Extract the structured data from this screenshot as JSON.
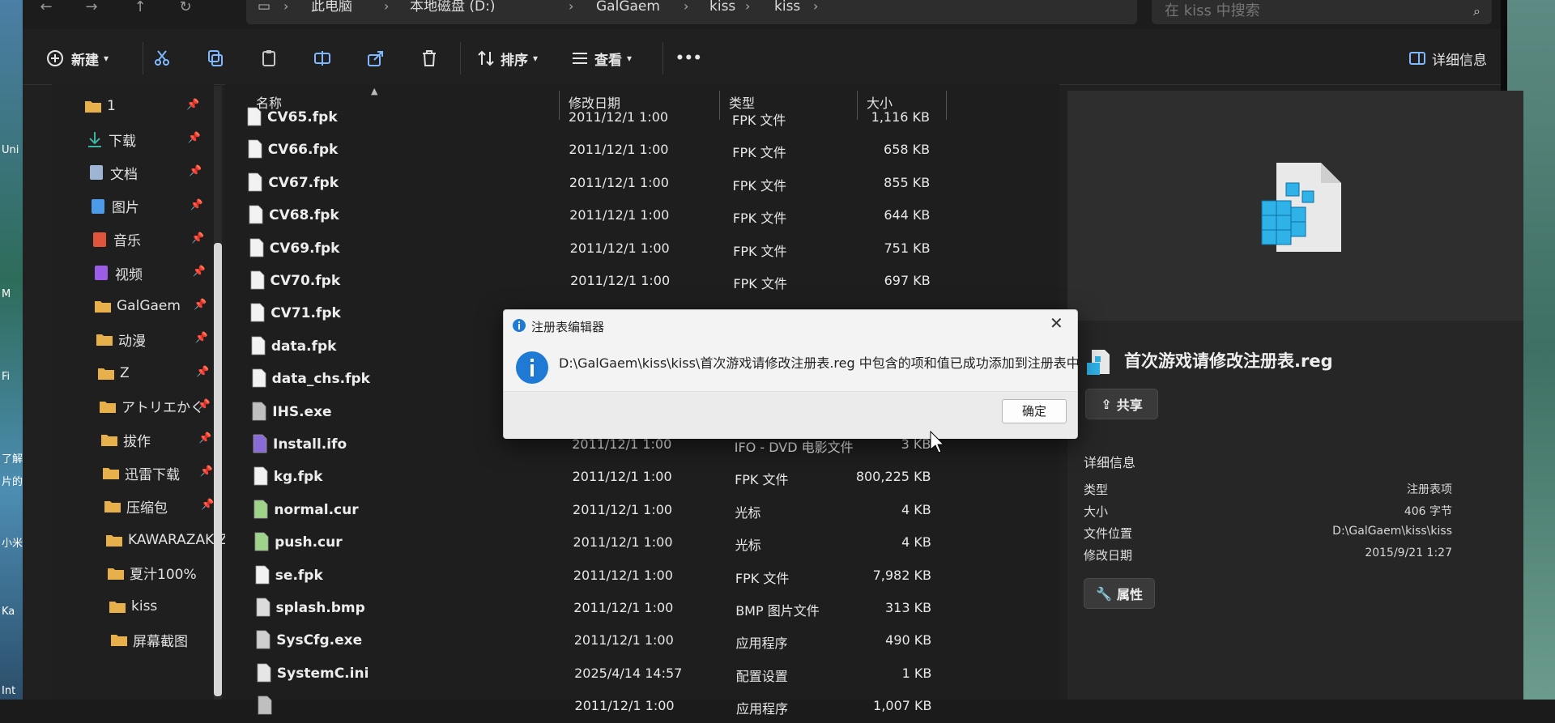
{
  "desktop": {
    "left_labels": [
      "Uni",
      "M",
      "Fi",
      "了解有",
      "片的",
      "小米",
      "Ka",
      "Int"
    ]
  },
  "address": {
    "crumbs": [
      "此电脑",
      "本地磁盘 (D:)",
      "GalGaem",
      "kiss",
      "kiss"
    ],
    "search_placeholder": "在 kiss 中搜索"
  },
  "toolbar": {
    "new_label": "新建",
    "sort_label": "排序",
    "view_label": "查看",
    "more_label": "•••",
    "details_label": "详细信息"
  },
  "sidebar": {
    "items": [
      {
        "label": "1",
        "icon": "folder-icon",
        "pinned": true
      },
      {
        "label": "下载",
        "icon": "download-icon",
        "pinned": true
      },
      {
        "label": "文档",
        "icon": "document-icon",
        "pinned": true
      },
      {
        "label": "图片",
        "icon": "pictures-icon",
        "pinned": true
      },
      {
        "label": "音乐",
        "icon": "music-icon",
        "pinned": true
      },
      {
        "label": "视频",
        "icon": "video-icon",
        "pinned": true
      },
      {
        "label": "GalGaem",
        "icon": "folder-icon",
        "pinned": true
      },
      {
        "label": "动漫",
        "icon": "folder-icon",
        "pinned": true
      },
      {
        "label": "Z",
        "icon": "folder-icon",
        "pinned": true
      },
      {
        "label": "アトリエかく",
        "icon": "folder-icon",
        "pinned": true
      },
      {
        "label": "拔作",
        "icon": "folder-icon",
        "pinned": true
      },
      {
        "label": "迅雷下载",
        "icon": "folder-icon",
        "pinned": true
      },
      {
        "label": "压缩包",
        "icon": "folder-icon",
        "pinned": true
      },
      {
        "label": "KAWARAZAKIZ",
        "icon": "folder-icon",
        "pinned": false
      },
      {
        "label": "夏汁100%",
        "icon": "folder-icon",
        "pinned": false
      },
      {
        "label": "kiss",
        "icon": "folder-icon",
        "pinned": false
      },
      {
        "label": "屏幕截图",
        "icon": "folder-icon",
        "pinned": false
      }
    ]
  },
  "columns": {
    "name": "名称",
    "date": "修改日期",
    "type": "类型",
    "size": "大小"
  },
  "files": [
    {
      "name": "CV65.fpk",
      "date": "2011/12/1 1:00",
      "type": "FPK 文件",
      "size": "1,116 KB",
      "icon": "file-icon"
    },
    {
      "name": "CV66.fpk",
      "date": "2011/12/1 1:00",
      "type": "FPK 文件",
      "size": "658 KB",
      "icon": "file-icon"
    },
    {
      "name": "CV67.fpk",
      "date": "2011/12/1 1:00",
      "type": "FPK 文件",
      "size": "855 KB",
      "icon": "file-icon"
    },
    {
      "name": "CV68.fpk",
      "date": "2011/12/1 1:00",
      "type": "FPK 文件",
      "size": "644 KB",
      "icon": "file-icon"
    },
    {
      "name": "CV69.fpk",
      "date": "2011/12/1 1:00",
      "type": "FPK 文件",
      "size": "751 KB",
      "icon": "file-icon"
    },
    {
      "name": "CV70.fpk",
      "date": "2011/12/1 1:00",
      "type": "FPK 文件",
      "size": "697 KB",
      "icon": "file-icon"
    },
    {
      "name": "CV71.fpk",
      "date": "",
      "type": "",
      "size": "",
      "icon": "file-icon"
    },
    {
      "name": "data.fpk",
      "date": "",
      "type": "",
      "size": "",
      "icon": "file-icon"
    },
    {
      "name": "data_chs.fpk",
      "date": "",
      "type": "",
      "size": "",
      "icon": "file-icon"
    },
    {
      "name": "IHS.exe",
      "date": "",
      "type": "",
      "size": "",
      "icon": "exe-icon"
    },
    {
      "name": "Install.ifo",
      "date": "2011/12/1 1:00",
      "type": "IFO - DVD 电影文件",
      "size": "3 KB",
      "icon": "media-icon"
    },
    {
      "name": "kg.fpk",
      "date": "2011/12/1 1:00",
      "type": "FPK 文件",
      "size": "800,225 KB",
      "icon": "file-icon"
    },
    {
      "name": "normal.cur",
      "date": "2011/12/1 1:00",
      "type": "光标",
      "size": "4 KB",
      "icon": "cursor-icon"
    },
    {
      "name": "push.cur",
      "date": "2011/12/1 1:00",
      "type": "光标",
      "size": "4 KB",
      "icon": "cursor-icon"
    },
    {
      "name": "se.fpk",
      "date": "2011/12/1 1:00",
      "type": "FPK 文件",
      "size": "7,982 KB",
      "icon": "file-icon"
    },
    {
      "name": "splash.bmp",
      "date": "2011/12/1 1:00",
      "type": "BMP 图片文件",
      "size": "313 KB",
      "icon": "image-icon"
    },
    {
      "name": "SysCfg.exe",
      "date": "2011/12/1 1:00",
      "type": "应用程序",
      "size": "490 KB",
      "icon": "settings-exe-icon"
    },
    {
      "name": "SystemC.ini",
      "date": "2025/4/14 14:57",
      "type": "配置设置",
      "size": "1 KB",
      "icon": "ini-icon"
    },
    {
      "name": "",
      "date": "2011/12/1 1:00",
      "type": "应用程序",
      "size": "1,007 KB",
      "icon": "exe-icon"
    }
  ],
  "details": {
    "filename": "首次游戏请修改注册表.reg",
    "share_label": "共享",
    "section_title": "详细信息",
    "props": [
      {
        "key": "类型",
        "value": "注册表项"
      },
      {
        "key": "大小",
        "value": "406 字节"
      },
      {
        "key": "文件位置",
        "value": "D:\\GalGaem\\kiss\\kiss"
      },
      {
        "key": "修改日期",
        "value": "2015/9/21 1:27"
      }
    ],
    "properties_label": "属性"
  },
  "dialog": {
    "title": "注册表编辑器",
    "message": "D:\\GalGaem\\kiss\\kiss\\首次游戏请修改注册表.reg 中包含的项和值已成功添加到注册表中。",
    "ok_label": "确定"
  }
}
